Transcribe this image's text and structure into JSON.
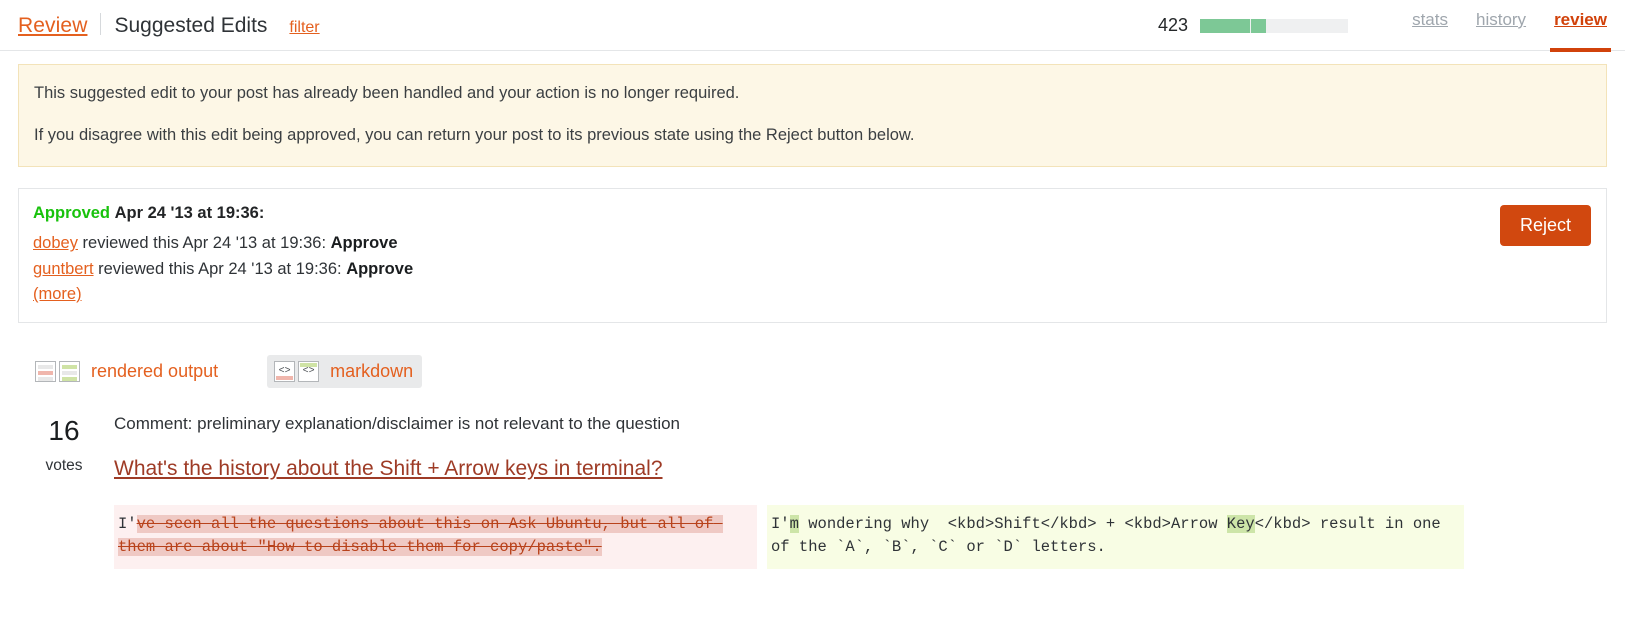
{
  "header": {
    "review_link": "Review",
    "section_title": "Suggested Edits",
    "filter_link": "filter",
    "reputation": "423",
    "progress_percent": 44,
    "tabs": [
      {
        "label": "stats",
        "active": false
      },
      {
        "label": "history",
        "active": false
      },
      {
        "label": "review",
        "active": true
      }
    ],
    "accent_color": "#d1420b",
    "link_color": "#e4601f",
    "progress_color": "#7dc896"
  },
  "notice": {
    "line1": "This suggested edit to your post has already been handled and your action is no longer required.",
    "line2": "If you disagree with this edit being approved, you can return your post to its previous state using the Reject button below.",
    "background": "#fdf7e6",
    "border": "#f3e3b9"
  },
  "approved_panel": {
    "status": "Approved",
    "status_color": "#18c20c",
    "date": "Apr 24 '13 at 19:36:",
    "reviews": [
      {
        "user": "dobey",
        "middle": " reviewed this Apr 24 '13 at 19:36: ",
        "verdict": "Approve"
      },
      {
        "user": "guntbert",
        "middle": " reviewed this Apr 24 '13 at 19:36: ",
        "verdict": "Approve"
      }
    ],
    "more_label": "(more)",
    "reject_label": "Reject",
    "reject_color": "#d1480f"
  },
  "view_toggles": [
    {
      "label": "rendered output",
      "icon": "split-panels-icon",
      "selected": false
    },
    {
      "label": "markdown",
      "icon": "split-code-icon",
      "selected": true
    }
  ],
  "post": {
    "votes_count": "16",
    "votes_label": "votes",
    "comment_prefix": "Comment:",
    "comment_text": " preliminary explanation/disclaimer is not relevant to the question",
    "title": "What's the history about the Shift + Arrow keys in terminal?",
    "title_color": "#9e3b26"
  },
  "diff": {
    "left": {
      "background": "#fdf0f0",
      "highlight": "#efc9c4",
      "segments": [
        {
          "text": "I'",
          "type": "context"
        },
        {
          "text": "ve seen all the questions about this on Ask Ubuntu, but all of them are about \"How to disable them for copy/paste\".",
          "type": "deleted"
        }
      ]
    },
    "right": {
      "background": "#f8fde4",
      "highlight": "#cde5a8",
      "segments": [
        {
          "text": "I'",
          "type": "context"
        },
        {
          "text": "m",
          "type": "inserted"
        },
        {
          "text": " wondering why  <kbd>Shift</kbd> + <kbd>Arrow ",
          "type": "context"
        },
        {
          "text": "Key",
          "type": "inserted"
        },
        {
          "text": "</kbd> result in one of the `A`, `B`, `C` or `D` letters.",
          "type": "context"
        }
      ]
    }
  }
}
